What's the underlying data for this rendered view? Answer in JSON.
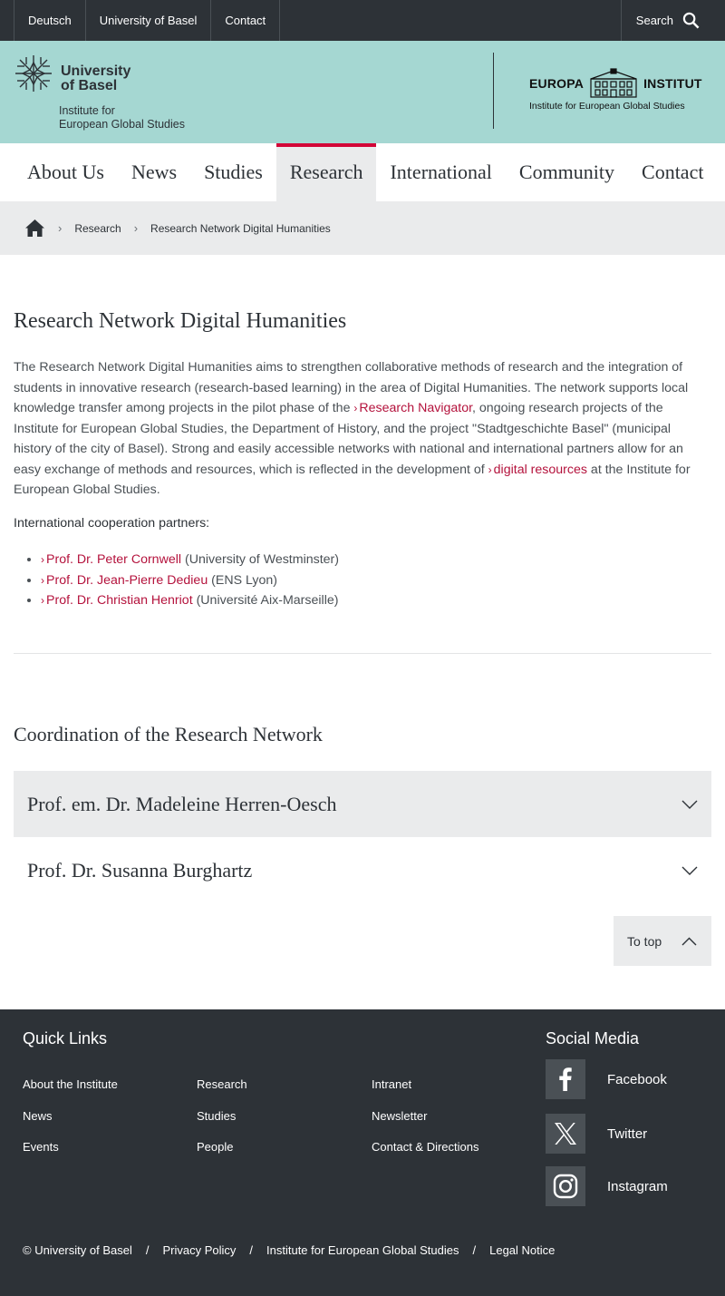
{
  "meta_nav": {
    "items": [
      "Deutsch",
      "University of Basel",
      "Contact"
    ],
    "search_label": "Search"
  },
  "header": {
    "university_line1": "University",
    "university_line2": "of Basel",
    "institute_line1": "Institute for",
    "institute_line2": "European Global Studies",
    "europa_left": "EUROPA",
    "europa_right": "INSTITUT",
    "europa_sub": "Institute for European Global Studies"
  },
  "main_nav": {
    "items": [
      "About Us",
      "News",
      "Studies",
      "Research",
      "International",
      "Community",
      "Contact"
    ],
    "active": "Research"
  },
  "breadcrumb": {
    "items": [
      "Research",
      "Research Network Digital Humanities"
    ]
  },
  "content": {
    "title": "Research Network Digital Humanities",
    "para_part1": "The Research Network Digital Humanities aims to strengthen collaborative methods of research and the integration of students in innovative research (research-based learning) in the area of Digital Humanities. The network supports local knowledge transfer among projects in the pilot phase of the ",
    "link_research_navigator": "Research Navigator",
    "para_part2": ", ongoing research projects of the Institute for European Global Studies, the Department of History, and the project \"Stadtgeschichte Basel\" (municipal history of the city of Basel). Strong and easily accessible networks with national and international partners allow for an easy exchange of methods and resources, which is reflected in the development of ",
    "link_digital_resources": "digital resources",
    "para_part3": " at the Institute for European Global Studies.",
    "cooperation_label": "International cooperation partners:",
    "partners": [
      {
        "name": "Prof. Dr. Peter Cornwell",
        "affiliation": " (University of Westminster)"
      },
      {
        "name": "Prof. Dr. Jean-Pierre Dedieu",
        "affiliation": " (ENS Lyon)"
      },
      {
        "name": "Prof. Dr. Christian Henriot",
        "affiliation": " (Université Aix-Marseille)"
      }
    ],
    "coordination_title": "Coordination of the Research Network",
    "accordion": [
      "Prof. em. Dr. Madeleine Herren-Oesch",
      "Prof. Dr. Susanna Burghartz"
    ],
    "to_top": "To top"
  },
  "footer": {
    "quick_links_title": "Quick Links",
    "col1": [
      "About the Institute",
      "News",
      "Events"
    ],
    "col2": [
      "Research",
      "Studies",
      "People"
    ],
    "col3": [
      "Intranet",
      "Newsletter",
      "Contact & Directions"
    ],
    "social_title": "Social Media",
    "social": [
      "Facebook",
      "Twitter",
      "Instagram"
    ],
    "legal": [
      "© University of Basel",
      "Privacy Policy",
      "Institute for European Global Studies",
      "Legal Notice"
    ]
  },
  "colors": {
    "dark": "#2d3237",
    "mint": "#a5d7d2",
    "accent_red": "#d20537",
    "link_red": "#b4123c",
    "light_gray": "#eaebec"
  }
}
